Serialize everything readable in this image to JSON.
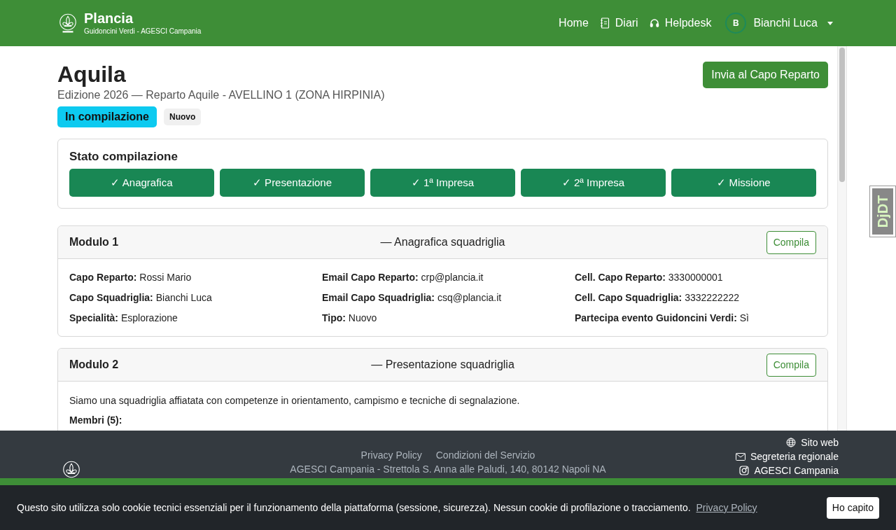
{
  "header": {
    "brand_title": "Plancia",
    "brand_subtitle": "Guidoncini Verdi - AGESCI Campania",
    "nav": [
      {
        "label": "Home",
        "kind": "plain"
      },
      {
        "label": "Diari",
        "kind": "notebook"
      },
      {
        "label": "Helpdesk",
        "kind": "headset"
      }
    ],
    "user": {
      "initial": "B",
      "name": "Bianchi Luca"
    }
  },
  "page": {
    "title": "Aquila",
    "subtitle": "Edizione 2026 — Reparto Aquile - AVELLINO 1 (ZONA HIRPINIA)",
    "badges": [
      {
        "label": "In compilazione",
        "kind": "status"
      },
      {
        "label": "Nuovo",
        "kind": "tag"
      }
    ],
    "action_button": "Invia al Capo Reparto"
  },
  "progress": {
    "title": "Stato compilazione",
    "steps": [
      {
        "label": "✓ Anagrafica",
        "done": true
      },
      {
        "label": "✓ Presentazione",
        "done": true
      },
      {
        "label": "✓ 1ª Impresa",
        "done": true
      },
      {
        "label": "✓ 2ª Impresa",
        "done": true
      },
      {
        "label": "✓ Missione",
        "done": true
      }
    ]
  },
  "modules": [
    {
      "title": "Modulo 1",
      "subtitle": "— Anagrafica squadriglia",
      "button": "Compila",
      "fields": [
        {
          "label": "Capo Reparto:",
          "value": "Rossi Mario"
        },
        {
          "label": "Email Capo Reparto:",
          "value": "crp@plancia.it"
        },
        {
          "label": "Cell. Capo Reparto:",
          "value": "3330000001"
        },
        {
          "label": "Capo Squadriglia:",
          "value": "Bianchi Luca"
        },
        {
          "label": "Email Capo Squadriglia:",
          "value": "csq@plancia.it"
        },
        {
          "label": "Cell. Capo Squadriglia:",
          "value": "3332222222"
        },
        {
          "label": "Specialità:",
          "value": "Esplorazione"
        },
        {
          "label": "Tipo:",
          "value": "Nuovo"
        },
        {
          "label": "Partecipa evento Guidoncini Verdi:",
          "value": "Sì"
        }
      ]
    },
    {
      "title": "Modulo 2",
      "subtitle": "— Presentazione squadriglia",
      "button": "Compila",
      "description": "Siamo una squadriglia affiatata con competenze in orientamento, campismo e tecniche di segnalazione.",
      "members_label": "Membri (5):"
    }
  ],
  "footer": {
    "links": [
      "Privacy Policy",
      "Condizioni del Servizio"
    ],
    "address": "AGESCI Campania - Strettola S. Anna alle Paludi, 140, 80142 Napoli NA",
    "contacts": [
      {
        "label": "Sito web",
        "kind": "globe"
      },
      {
        "label": "Segreteria regionale",
        "kind": "mail"
      },
      {
        "label": "AGESCI Campania",
        "kind": "instagram"
      }
    ]
  },
  "cookie": {
    "text": "Questo sito utilizza solo cookie tecnici essenziali per il funzionamento della piattaforma (sessione, sicurezza). Nessun cookie di profilazione o tracciamento.",
    "link": "Privacy Policy",
    "button": "Ho capito"
  },
  "devtools": {
    "label": "DjDT"
  }
}
